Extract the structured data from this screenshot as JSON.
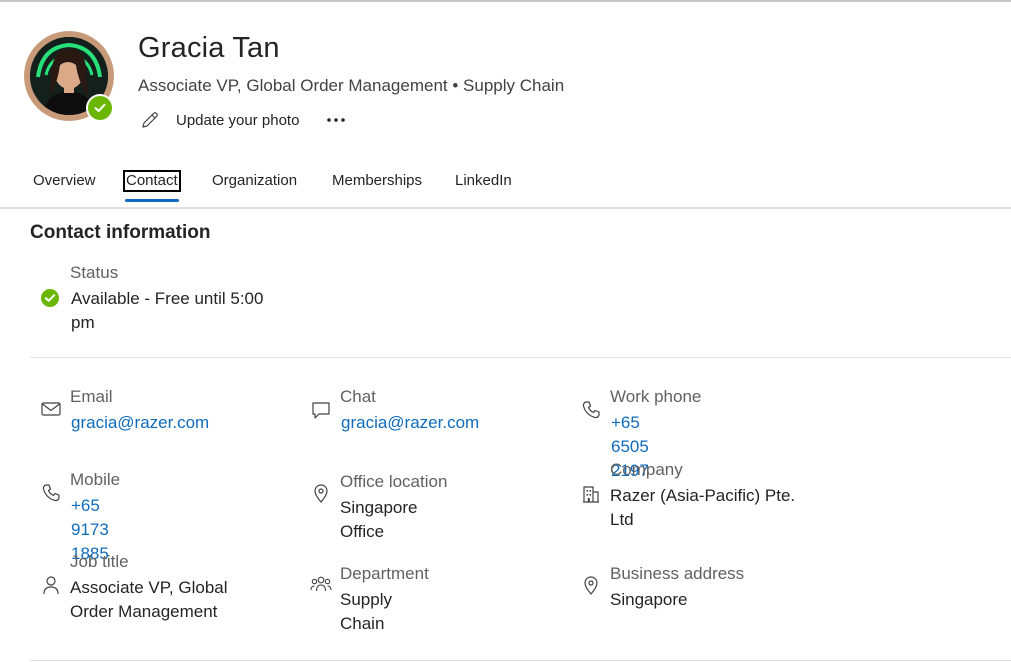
{
  "profile": {
    "name": "Gracia Tan",
    "subtitle": "Associate VP, Global Order Management • Supply Chain",
    "update_photo_label": "Update your photo",
    "more_label": "•••"
  },
  "tabs": [
    {
      "label": "Overview",
      "active": false
    },
    {
      "label": "Contact",
      "active": true
    },
    {
      "label": "Organization",
      "active": false
    },
    {
      "label": "Memberships",
      "active": false
    },
    {
      "label": "LinkedIn",
      "active": false
    }
  ],
  "contact": {
    "section_title": "Contact information",
    "status": {
      "label": "Status",
      "value": "Available - Free until 5:00 pm",
      "icon": "available-check-icon"
    },
    "fields": [
      {
        "label": "Email",
        "value": "gracia@razer.com",
        "icon": "mail-icon",
        "link": true
      },
      {
        "label": "Chat",
        "value": "gracia@razer.com",
        "icon": "chat-icon",
        "link": true
      },
      {
        "label": "Work phone",
        "value": "+65 6505 2197",
        "icon": "phone-icon",
        "link": true
      },
      {
        "label": "Mobile",
        "value": "+65 9173 1885",
        "icon": "phone-icon",
        "link": true
      },
      {
        "label": "Office location",
        "value": "Singapore Office",
        "icon": "location-icon",
        "link": false
      },
      {
        "label": "Company",
        "value": "Razer (Asia-Pacific) Pte. Ltd",
        "icon": "building-icon",
        "link": false
      },
      {
        "label": "Job title",
        "value": "Associate VP, Global Order Management",
        "icon": "person-icon",
        "link": false
      },
      {
        "label": "Department",
        "value": "Supply Chain",
        "icon": "people-icon",
        "link": false
      },
      {
        "label": "Business address",
        "value": "Singapore",
        "icon": "location-icon",
        "link": false
      }
    ]
  },
  "colors": {
    "accent": "#0f6cbd",
    "presence_available": "#6bb700",
    "avatar_ring": "#c79a7a"
  }
}
